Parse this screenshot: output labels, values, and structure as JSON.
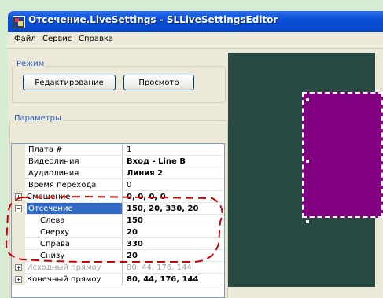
{
  "window": {
    "title": "Отсечение.LiveSettings - SLLiveSettingsEditor"
  },
  "menu": [
    {
      "label": "Файл"
    },
    {
      "label": "Сервис"
    },
    {
      "label": "Справка"
    }
  ],
  "mode": {
    "group_title": "Режим",
    "edit_button": "Редактирование",
    "view_button": "Просмотр"
  },
  "params": {
    "group_title": "Параметры",
    "rows": [
      {
        "label": "Плата #",
        "value": "1"
      },
      {
        "label": "Видеолиния",
        "value": "Вход - Line B"
      },
      {
        "label": "Аудиолиния",
        "value": "Линия 2"
      },
      {
        "label": "Время перехода",
        "value": "0"
      },
      {
        "label": "Смещение",
        "value": "0, 0, 0, 0",
        "expander": "+"
      },
      {
        "label": "Отсечение",
        "value": "150, 20, 330, 20",
        "expander": "−"
      },
      {
        "label": "Слева",
        "value": "150"
      },
      {
        "label": "Сверху",
        "value": "20"
      },
      {
        "label": "Справа",
        "value": "330"
      },
      {
        "label": "Снизу",
        "value": "20"
      },
      {
        "label": "Исходный прямоу",
        "value": "80, 44, 176, 144",
        "expander": "+"
      },
      {
        "label": "Конечный прямоу",
        "value": "80, 44, 176, 144",
        "expander": "+"
      }
    ]
  },
  "colors": {
    "preview_background": "#294a43",
    "crop_rect": "#800080",
    "selection": "#316ac5",
    "annotation": "#d00000"
  },
  "icons": [
    "app-icon",
    "expand-icon",
    "collapse-icon"
  ]
}
